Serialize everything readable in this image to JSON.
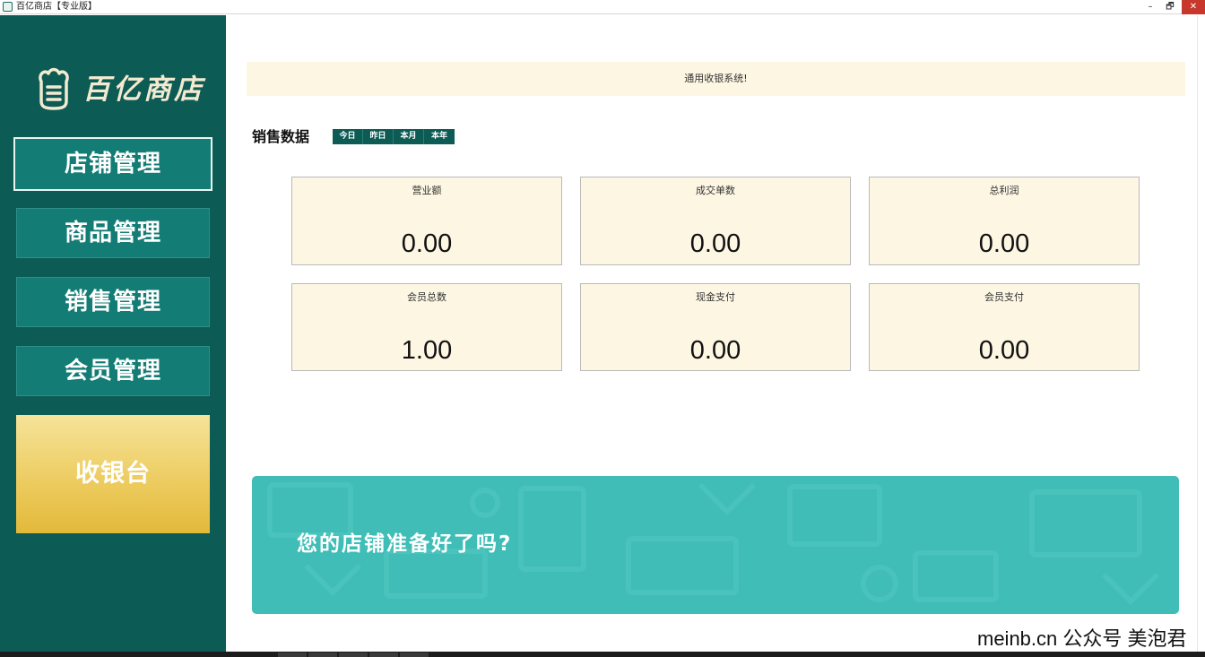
{
  "window": {
    "title": "百亿商店【专业版】",
    "controls": {
      "minimize": "–",
      "maximize": "🗗",
      "close": "✕"
    }
  },
  "sidebar": {
    "logo_text": "百亿商店",
    "nav": [
      {
        "label": "店铺管理",
        "active": true
      },
      {
        "label": "商品管理",
        "active": false
      },
      {
        "label": "销售管理",
        "active": false
      },
      {
        "label": "会员管理",
        "active": false
      }
    ],
    "cashier_label": "收银台"
  },
  "notice": {
    "text": "通用收银系统!"
  },
  "sales": {
    "title": "销售数据",
    "periods": [
      "今日",
      "昨日",
      "本月",
      "本年"
    ],
    "stats": [
      {
        "label": "营业额",
        "value": "0.00"
      },
      {
        "label": "成交单数",
        "value": "0.00"
      },
      {
        "label": "总利润",
        "value": "0.00"
      },
      {
        "label": "会员总数",
        "value": "1.00"
      },
      {
        "label": "现金支付",
        "value": "0.00"
      },
      {
        "label": "会员支付",
        "value": "0.00"
      }
    ]
  },
  "promo": {
    "text": "您的店铺准备好了吗?"
  },
  "watermark": {
    "text": "meinb.cn  公众号 美泡君"
  },
  "colors": {
    "sidebar_bg": "#0c5b55",
    "nav_item_bg": "#137c74",
    "card_bg": "#fdf6e3",
    "promo_bg": "#3fbdb6",
    "cashier_gold": "#ecca5c",
    "close_red": "#c7372c"
  }
}
